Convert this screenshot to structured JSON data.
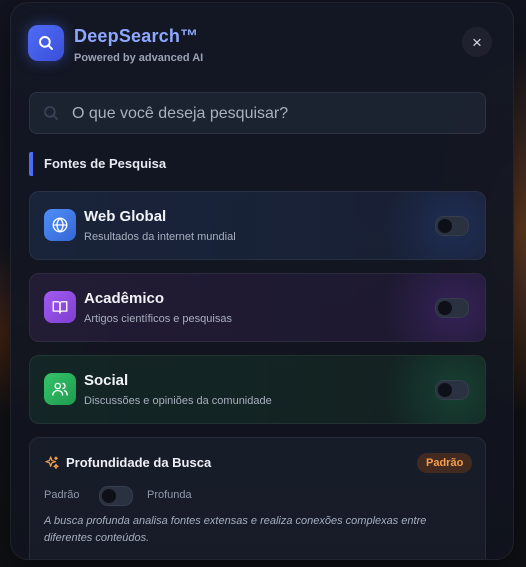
{
  "app": {
    "title": "DeepSearch™",
    "subtitle": "Powered by advanced AI",
    "close_symbol": "×",
    "logo_icon": "search-icon",
    "accent_color": "#4f6cf7"
  },
  "search": {
    "placeholder": "O que você deseja pesquisar?",
    "value": "",
    "icon": "search-icon"
  },
  "sources": {
    "section_title": "Fontes de Pesquisa",
    "items": [
      {
        "name": "Web Global",
        "description": "Resultados da internet mundial",
        "icon": "globe-icon",
        "color": "#4f8ff7",
        "enabled": false
      },
      {
        "name": "Acadêmico",
        "description": "Artigos científicos e pesquisas",
        "icon": "book-icon",
        "color": "#a25af0",
        "enabled": false
      },
      {
        "name": "Social",
        "description": "Discussões e opiniões da comunidade",
        "icon": "users-icon",
        "color": "#34c46a",
        "enabled": false
      }
    ]
  },
  "depth": {
    "title": "Profundidade da Busca",
    "badge": "Padrão",
    "badge_color": "#f59e4b",
    "left_label": "Padrão",
    "right_label": "Profunda",
    "deep_enabled": false,
    "note": "A busca profunda analisa fontes extensas e realiza conexões complexas entre diferentes conteúdos.",
    "icon": "sparkles-icon"
  }
}
